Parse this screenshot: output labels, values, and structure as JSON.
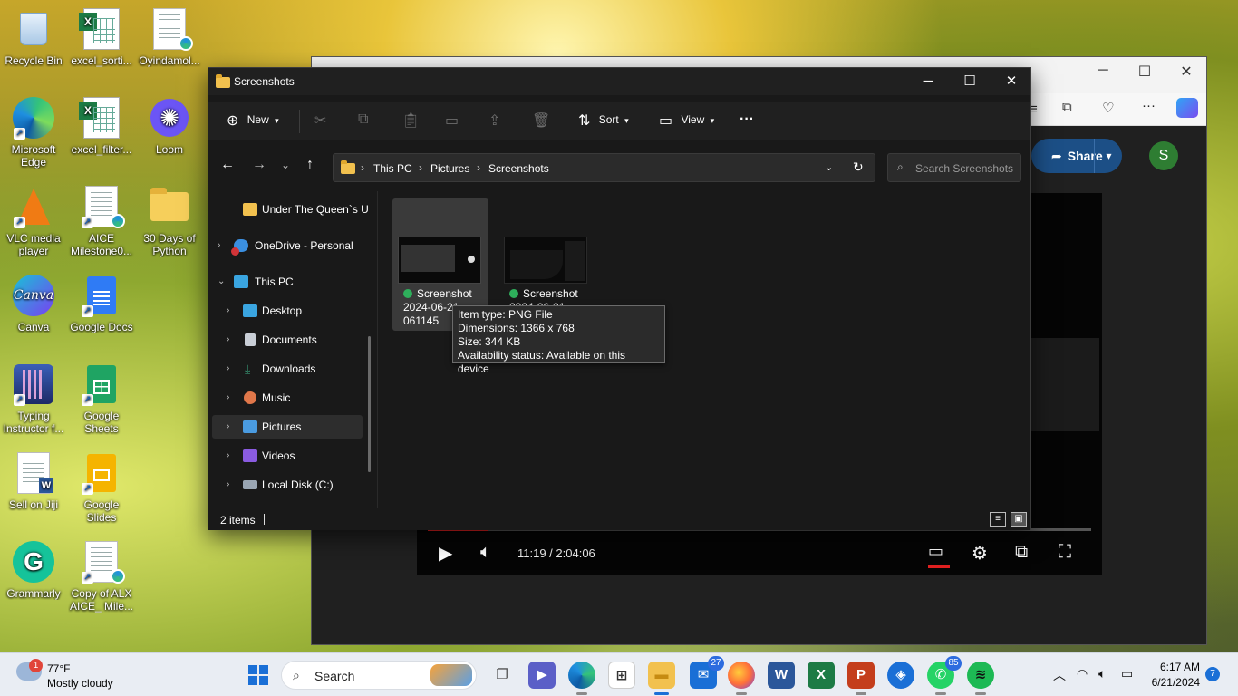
{
  "desktop": {
    "icons": [
      {
        "label": "Recycle Bin"
      },
      {
        "label": "excel_sorti..."
      },
      {
        "label": "Oyindamol..."
      },
      {
        "label": "Microsoft Edge"
      },
      {
        "label": "excel_filter..."
      },
      {
        "label": "Loom"
      },
      {
        "label": "VLC media player"
      },
      {
        "label": "AICE Milestone0..."
      },
      {
        "label": "30 Days of Python"
      },
      {
        "label": "Canva"
      },
      {
        "label": "Google Docs"
      },
      {
        "label": "Typing Instructor f..."
      },
      {
        "label": "Google Sheets"
      },
      {
        "label": "Sell on Jiji"
      },
      {
        "label": "Google Slides"
      },
      {
        "label": "Grammarly"
      },
      {
        "label": "Copy of ALX AICE_ Mile..."
      }
    ]
  },
  "browser": {
    "share_label": "Share",
    "avatar_letter": "S",
    "video": {
      "time": "11:19 / 2:04:06",
      "progress_fraction": 0.091
    }
  },
  "explorer": {
    "title": "Screenshots",
    "command_bar": {
      "new_label": "New",
      "sort_label": "Sort",
      "view_label": "View",
      "more_label": "···"
    },
    "breadcrumb": [
      "This PC",
      "Pictures",
      "Screenshots"
    ],
    "search_placeholder": "Search Screenshots",
    "nav": [
      {
        "label": "Under The Queen`s U",
        "icon": "folder-icon"
      },
      {
        "label": "OneDrive - Personal",
        "icon": "onedrive-icon"
      },
      {
        "label": "This PC",
        "icon": "this-pc-icon"
      },
      {
        "label": "Desktop",
        "icon": "desktop-icon"
      },
      {
        "label": "Documents",
        "icon": "documents-icon"
      },
      {
        "label": "Downloads",
        "icon": "downloads-icon"
      },
      {
        "label": "Music",
        "icon": "music-icon"
      },
      {
        "label": "Pictures",
        "icon": "pictures-icon"
      },
      {
        "label": "Videos",
        "icon": "videos-icon"
      },
      {
        "label": "Local Disk (C:)",
        "icon": "local-disk-icon"
      }
    ],
    "files": [
      {
        "line1": "Screenshot",
        "line2": "2024-06-21",
        "line3": "061145"
      },
      {
        "line1": "Screenshot",
        "line2": "2024-06-21"
      }
    ],
    "tooltip": {
      "type": "Item type: PNG File",
      "dimensions": "Dimensions: 1366 x 768",
      "size": "Size: 344 KB",
      "availability": "Availability status: Available on this device"
    },
    "status": "2 items"
  },
  "taskbar": {
    "weather_temp": "77°F",
    "weather_desc": "Mostly cloudy",
    "weather_badge": "1",
    "search_label": "Search",
    "outlook_badge": "27",
    "whatsapp_badge": "85",
    "time": "6:17 AM",
    "date": "6/21/2024",
    "notification_count": "7",
    "app_colors": {
      "start": "#1a6fd6",
      "file_explorer": "#f2c14e",
      "word": "#2b579a",
      "excel": "#1d7b45",
      "powerpoint": "#c43e1c",
      "whatsapp": "#25d366",
      "spotify": "#1db954"
    }
  }
}
